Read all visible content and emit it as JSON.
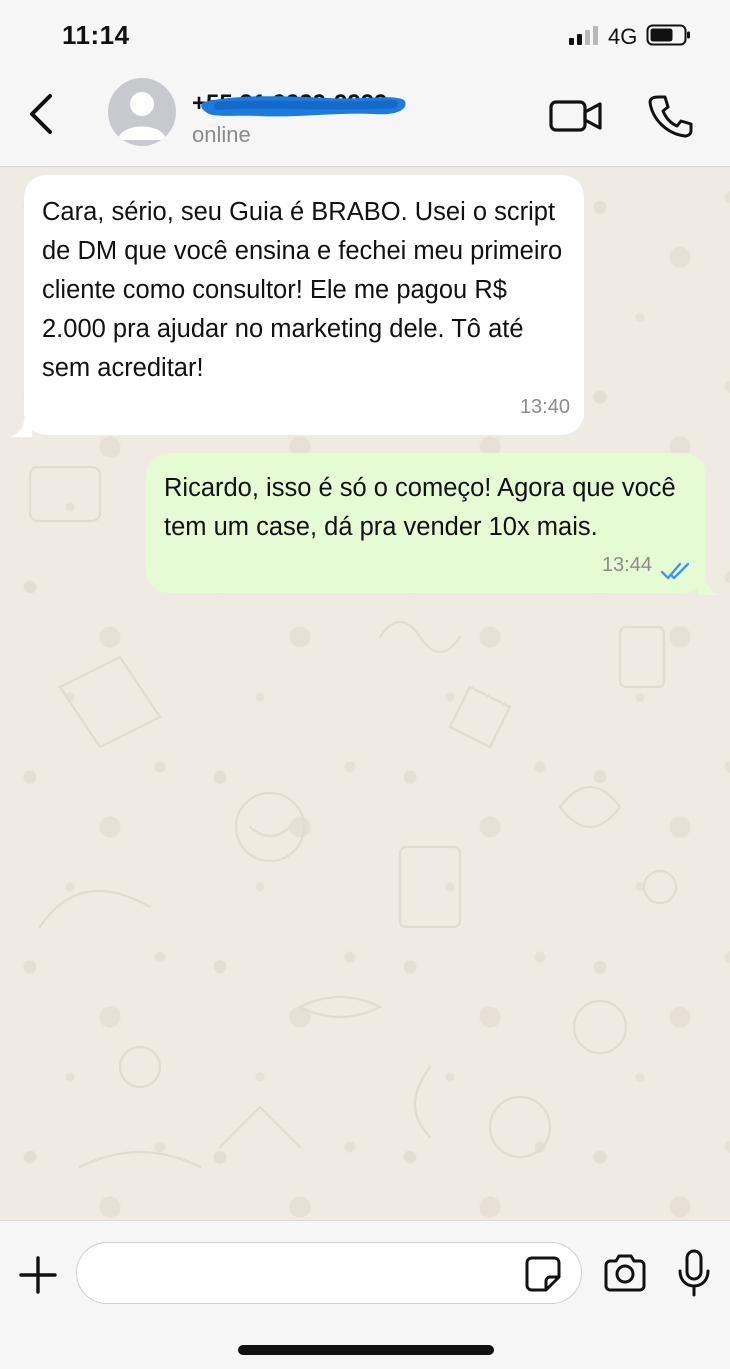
{
  "status_bar": {
    "time": "11:14",
    "network": "4G",
    "signal_icon": "signal-bars-icon",
    "battery_icon": "battery-icon"
  },
  "header": {
    "contact_name": "+55 31 9999-9999",
    "contact_name_redacted": true,
    "status": "online",
    "icons": {
      "back": "chevron-left-icon",
      "avatar": "default-avatar-icon",
      "video": "video-camera-icon",
      "voice": "phone-icon"
    }
  },
  "messages": [
    {
      "direction": "incoming",
      "text": "Cara, sério, seu Guia é BRABO. Usei o script de DM que você ensina e fechei meu primeiro cliente como consultor! Ele me pagou R$ 2.000 pra ajudar no marketing dele. Tô até sem acreditar!",
      "time": "13:40"
    },
    {
      "direction": "outgoing",
      "text": "Ricardo, isso é só o começo! Agora que você tem um case, dá pra vender 10x mais.",
      "time": "13:44",
      "status": "read",
      "status_icon": "double-check-icon"
    }
  ],
  "composer": {
    "placeholder": "",
    "value": "",
    "icons": {
      "attach": "plus-icon",
      "sticker": "sticker-icon",
      "camera": "camera-icon",
      "mic": "microphone-icon"
    }
  },
  "colors": {
    "chat_background": "#efeae2",
    "incoming_bubble": "#ffffff",
    "outgoing_bubble": "#e4fbd4",
    "read_receipt": "#3a97f2",
    "redaction": "#1a7be0"
  }
}
